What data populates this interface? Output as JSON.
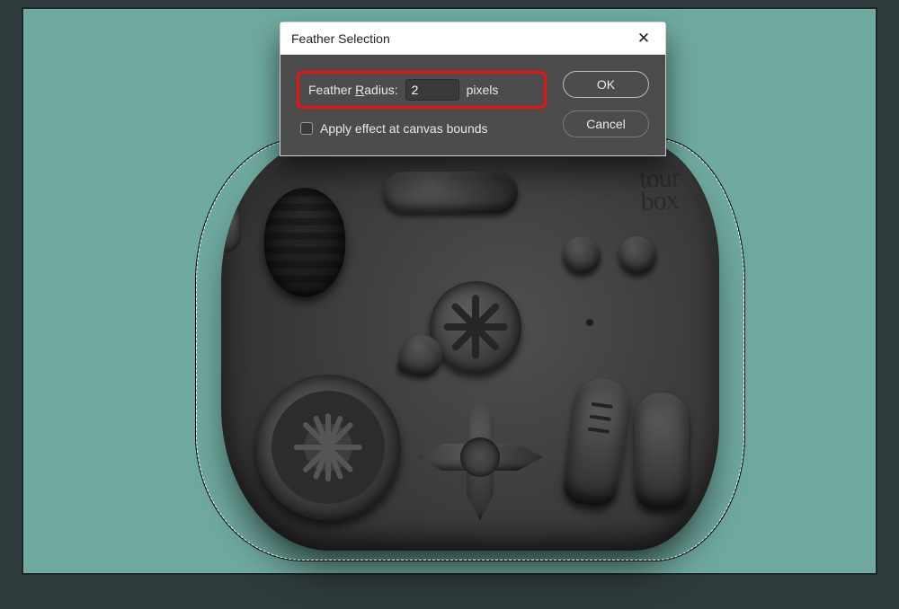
{
  "dialog": {
    "title": "Feather Selection",
    "feather_label_prefix": "Feather ",
    "feather_label_hot": "R",
    "feather_label_suffix": "adius:",
    "feather_value": "2",
    "feather_unit": "pixels",
    "apply_label": "Apply effect at canvas bounds",
    "ok_label": "OK",
    "cancel_label": "Cancel"
  },
  "device": {
    "brand_line1": "tour",
    "brand_line2": "box"
  }
}
